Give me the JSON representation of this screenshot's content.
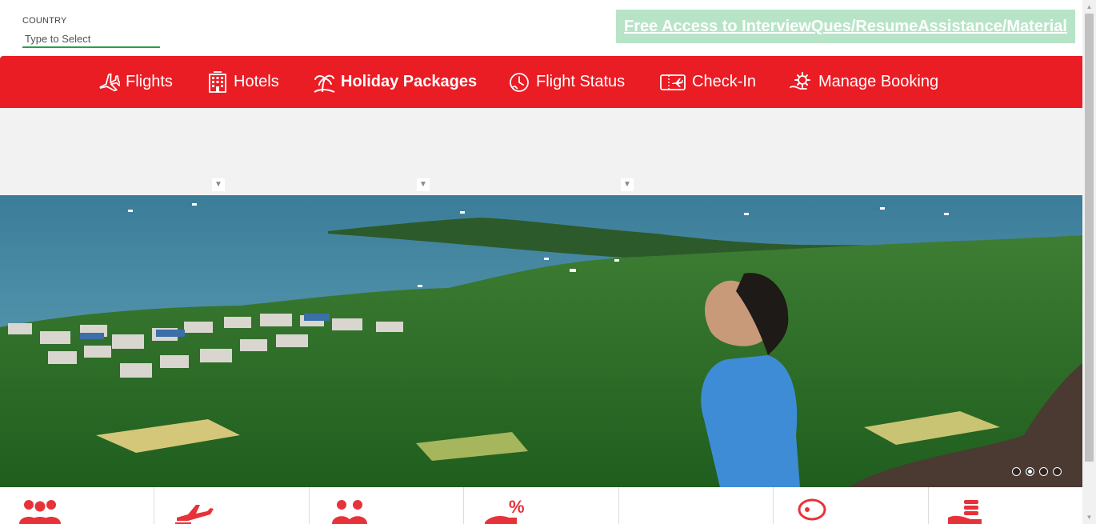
{
  "country": {
    "label": "COUNTRY",
    "placeholder": "Type to Select"
  },
  "promo": {
    "text": "Free Access to InterviewQues/ResumeAssistance/Material"
  },
  "nav": {
    "items": [
      {
        "label": "Flights",
        "icon": "airplane-icon"
      },
      {
        "label": "Hotels",
        "icon": "hotel-building-icon"
      },
      {
        "label": "Holiday Packages",
        "icon": "palm-tree-icon"
      },
      {
        "label": "Flight Status",
        "icon": "clock-status-icon"
      },
      {
        "label": "Check-In",
        "icon": "ticket-icon"
      },
      {
        "label": "Manage Booking",
        "icon": "gear-hand-icon"
      }
    ],
    "active": "Holiday Packages"
  },
  "hero": {
    "slide_count": 4,
    "active_slide": 2
  },
  "colors": {
    "nav_bg": "#ea1c24",
    "promo_bg": "#b7e4c7",
    "input_underline": "#2e9b4e",
    "feature_icon": "#e8323a"
  },
  "features": [
    {
      "icon": "group-people-icon"
    },
    {
      "icon": "plane-takeoff-icon"
    },
    {
      "icon": "business-people-icon"
    },
    {
      "icon": "discount-percent-icon"
    },
    {
      "icon": ""
    },
    {
      "icon": "chat-bubble-icon"
    },
    {
      "icon": "coins-hand-icon"
    }
  ]
}
